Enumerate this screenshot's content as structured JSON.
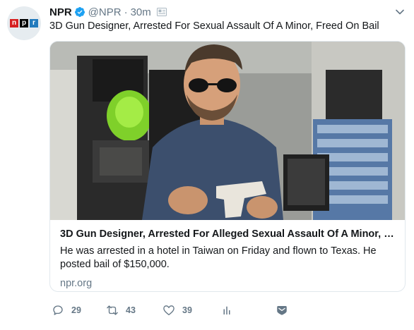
{
  "account": {
    "name": "NPR",
    "handle": "@NPR",
    "separator": "·",
    "time": "30m"
  },
  "avatar": {
    "letters": [
      "n",
      "p",
      "r"
    ]
  },
  "tweet": {
    "text": "3D Gun Designer, Arrested For Sexual Assault Of A Minor, Freed On Bail"
  },
  "card": {
    "title": "3D Gun Designer, Arrested For Alleged Sexual Assault Of A Minor, Fr...",
    "description": "He was arrested in a hotel in Taiwan on Friday and flown to Texas. He posted bail of $150,000.",
    "domain": "npr.org"
  },
  "actions": {
    "replies": "29",
    "retweets": "43",
    "likes": "39"
  },
  "colors": {
    "brand_blue": "#1da1f2",
    "muted": "#657786",
    "npr_red": "#d62021",
    "npr_blue": "#237bbd"
  }
}
